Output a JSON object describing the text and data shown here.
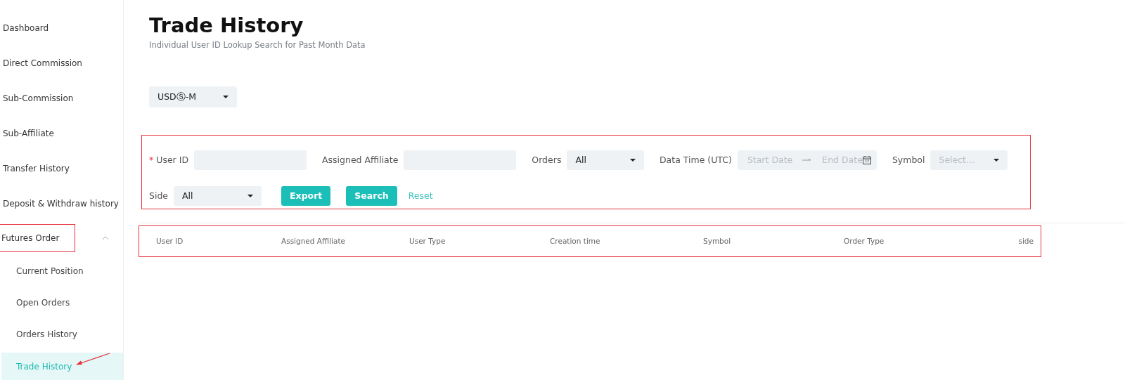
{
  "sidebar": {
    "items": [
      {
        "label": "Dashboard",
        "selected": false,
        "highlighted": false
      },
      {
        "label": "Direct Commission",
        "selected": false,
        "highlighted": false
      },
      {
        "label": "Sub-Commission",
        "selected": false,
        "highlighted": false
      },
      {
        "label": "Sub-Affiliate",
        "selected": false,
        "highlighted": false
      },
      {
        "label": "Transfer History",
        "selected": false,
        "highlighted": false
      },
      {
        "label": "Deposit & Withdraw history",
        "selected": false,
        "highlighted": false
      },
      {
        "label": "Futures Order",
        "selected": false,
        "highlighted": true,
        "expanded": true,
        "children": [
          {
            "label": "Current Position",
            "selected": false,
            "arrow": false
          },
          {
            "label": "Open Orders",
            "selected": false,
            "arrow": false
          },
          {
            "label": "Orders History",
            "selected": false,
            "arrow": false
          },
          {
            "label": "Trade History",
            "selected": true,
            "arrow": true
          }
        ]
      }
    ]
  },
  "page": {
    "title": "Trade History",
    "subtitle": "Individual User ID Lookup Search for Past Month Data"
  },
  "market_select": {
    "value": "USDⓈ-M"
  },
  "filters": {
    "highlighted": true,
    "fields": [
      {
        "kind": "text",
        "label": "User ID",
        "required_mark": "*"
      },
      {
        "kind": "text",
        "label": "Assigned Affiliate"
      },
      {
        "kind": "select",
        "label": "Orders",
        "value": "All"
      },
      {
        "kind": "daterange",
        "label": "Data Time (UTC)",
        "start_placeholder": "Start Date",
        "end_placeholder": "End Date"
      },
      {
        "kind": "select",
        "label": "Symbol",
        "placeholder": "Select..."
      },
      {
        "kind": "select",
        "label": "Side",
        "value": "All"
      }
    ],
    "actions": [
      {
        "kind": "button",
        "label": "Export"
      },
      {
        "kind": "button",
        "label": "Search"
      },
      {
        "kind": "link",
        "label": "Reset"
      }
    ]
  },
  "table": {
    "highlighted": true,
    "columns": [
      "User ID",
      "Assigned Affiliate",
      "User Type",
      "Creation time",
      "Symbol",
      "Order Type",
      "side"
    ]
  }
}
